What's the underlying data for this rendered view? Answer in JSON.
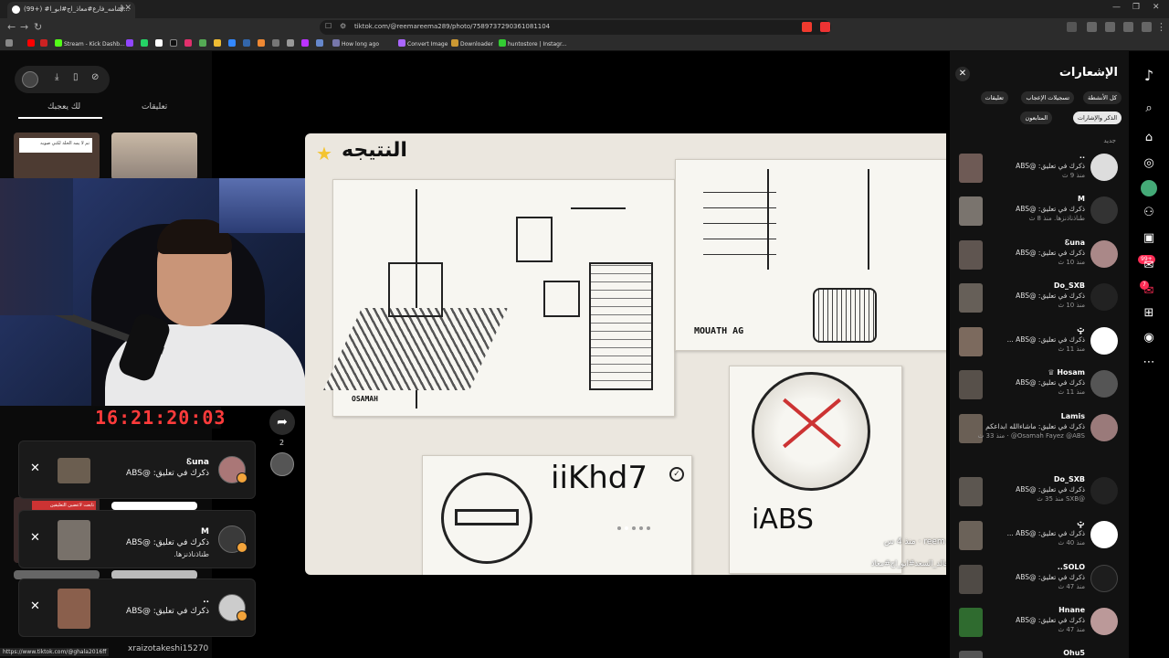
{
  "browser": {
    "tab_title": "(99+) #اسامه_فارع#معاذ_اج#ابو_ا...",
    "url": "tiktok.com/@reemareema289/photo/7589737290361081104",
    "status_url": "https://www.tiktok.com/@ghala2016ff",
    "bookmarks": [
      "Stream - Kick Dashb...",
      "How long ago",
      "Convert Image",
      "Downloader",
      "huntostore | Instagr..."
    ]
  },
  "left_panel": {
    "tabs": [
      "لك يعجبك",
      "تعليقات"
    ],
    "timer": "16:21:20:03",
    "thumb_caption": "تم لا يمه الحلة لكني صوبه",
    "thumb_label": "تابعت لاعضين التعليقين",
    "username_under": "xraizotakeshi15270"
  },
  "toasts": [
    {
      "name": "Ꮛuna",
      "line1": "ذكرك في تعليق: @ABS",
      "line2": ""
    },
    {
      "name": "M",
      "line1": "ذكرك في تعليق: @ABS",
      "line2": "طناذناذنزها."
    },
    {
      "name": "..",
      "line1": "ذكرك في تعليق: @ABS",
      "line2": ""
    }
  ],
  "share": {
    "count": "2"
  },
  "photo": {
    "title": "النتيجه",
    "labels": [
      "OSAMAH",
      "MOUATH AG",
      "iiKhd7",
      "iABS"
    ],
    "author": "reem · منذ 4 س",
    "caption": "#خالد_السعد#ابو_اج#معاذ"
  },
  "notifications": {
    "title": "الإشعارات",
    "chips": [
      "كل الأنشطة",
      "تسجيلات الإعجاب",
      "تعليقات",
      "الذكر والإشارات",
      "المتابعون"
    ],
    "section": "جديد",
    "items": [
      {
        "name": "..",
        "text": "ذكرك في تعليق: @ABS",
        "time": "منذ 9 ث"
      },
      {
        "name": "M",
        "text": "ذكرك في تعليق: @ABS",
        "time": "طناذناذنزها. منذ 8 ث"
      },
      {
        "name": "Ꮛuna",
        "text": "ذكرك في تعليق: @ABS",
        "time": "منذ 10 ث"
      },
      {
        "name": "Do_SXB",
        "text": "ذكرك في تعليق: @ABS",
        "time": "منذ 10 ث"
      },
      {
        "name": "ݓ",
        "text": "ذكرك في تعليق: @ABS ...",
        "time": "منذ 11 ث"
      },
      {
        "name": "Hosam ♕",
        "text": "ذكرك في تعليق: @ABS",
        "time": "منذ 11 ث"
      },
      {
        "name": "Lamis",
        "text": "ذكرك في تعليق: ماشاءالله ابداعكم",
        "time": "Osamah Fayez @ABS@ · منذ 33 ث"
      },
      {
        "name": "Do_SXB",
        "text": "ذكرك في تعليق: @ABS",
        "time": "@SXB منذ 35 ث"
      },
      {
        "name": "ݓ",
        "text": "ذكرك في تعليق: @ABS ...",
        "time": "منذ 40 ث"
      },
      {
        "name": "SOLO..",
        "text": "ذكرك في تعليق: @ABS",
        "time": "منذ 47 ث"
      },
      {
        "name": "Hnane",
        "text": "ذكرك في تعليق: @ABS",
        "time": "منذ 47 ث"
      },
      {
        "name": "Ohu5",
        "text": "",
        "time": ""
      }
    ]
  },
  "rail": {
    "badge_inbox": "99+",
    "badge_msg": "7"
  }
}
